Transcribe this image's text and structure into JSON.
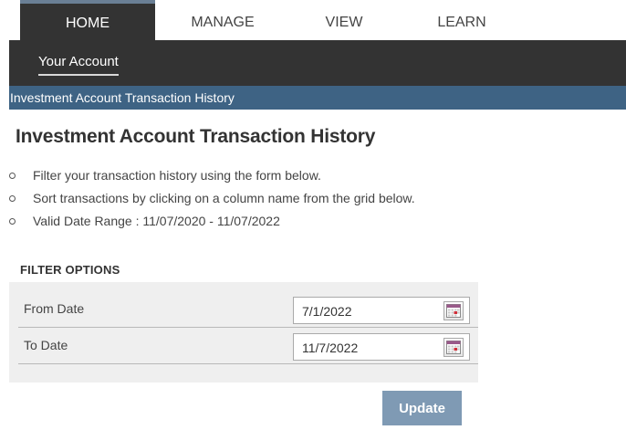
{
  "topnav": {
    "tabs": [
      {
        "label": "HOME",
        "active": true
      },
      {
        "label": "MANAGE"
      },
      {
        "label": "VIEW"
      },
      {
        "label": "LEARN"
      }
    ]
  },
  "subnav": {
    "item": "Your Account"
  },
  "title_bar": {
    "text": "Investment Account Transaction History"
  },
  "page": {
    "heading": "Investment Account Transaction History",
    "bullets": [
      "Filter your transaction history using the form below.",
      "Sort transactions by clicking on a column name from the grid below.",
      "Valid Date Range : 11/07/2020 - 11/07/2022"
    ]
  },
  "filter": {
    "section_label": "FILTER OPTIONS",
    "from_label": "From Date",
    "from_value": "7/1/2022",
    "to_label": "To Date",
    "to_value": "11/7/2022",
    "calendar_icon": "calendar-icon"
  },
  "actions": {
    "update_label": "Update"
  },
  "colors": {
    "nav_dark": "#333333",
    "title_bar": "#3e6384",
    "button": "#7f9ab4",
    "filter_bg": "#efefef"
  }
}
